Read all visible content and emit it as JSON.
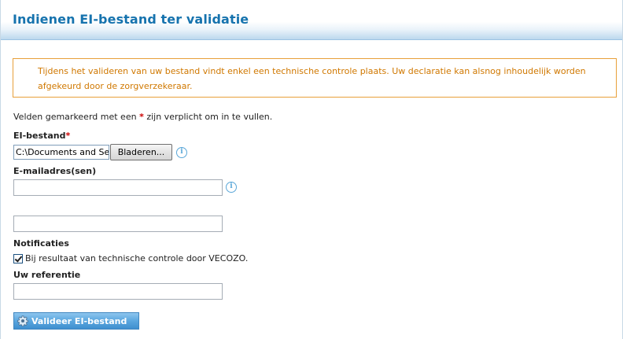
{
  "page": {
    "title": "Indienen EI-bestand ter validatie"
  },
  "notice": {
    "text": "Tijdens het valideren van uw bestand vindt enkel een technische controle plaats. Uw declaratie kan alsnog inhoudelijk worden afgekeurd door de zorgverzekeraar."
  },
  "form": {
    "required_note_before": "Velden gemarkeerd met een ",
    "required_star": "*",
    "required_note_after": " zijn verplicht om in te vullen.",
    "file": {
      "label": "EI-bestand",
      "required_star": "*",
      "value": "C:\\Documents and Settings",
      "browse_label": "Bladeren..."
    },
    "email": {
      "label": "E-mailadres(sen)",
      "field1_value": "",
      "field2_value": ""
    },
    "notifications": {
      "label": "Notificaties",
      "checkbox_label": "Bij resultaat van technische controle door VECOZO.",
      "checked": true
    },
    "reference": {
      "label": "Uw referentie",
      "value": ""
    },
    "submit_label": "Valideer EI-bestand"
  },
  "icons": {
    "info": "info-icon",
    "gear": "gear-icon"
  },
  "colors": {
    "title": "#1673ae",
    "notice_border": "#e8a03a",
    "notice_text": "#d07800",
    "required_star": "#cc0000",
    "button": "#5aa6df"
  }
}
